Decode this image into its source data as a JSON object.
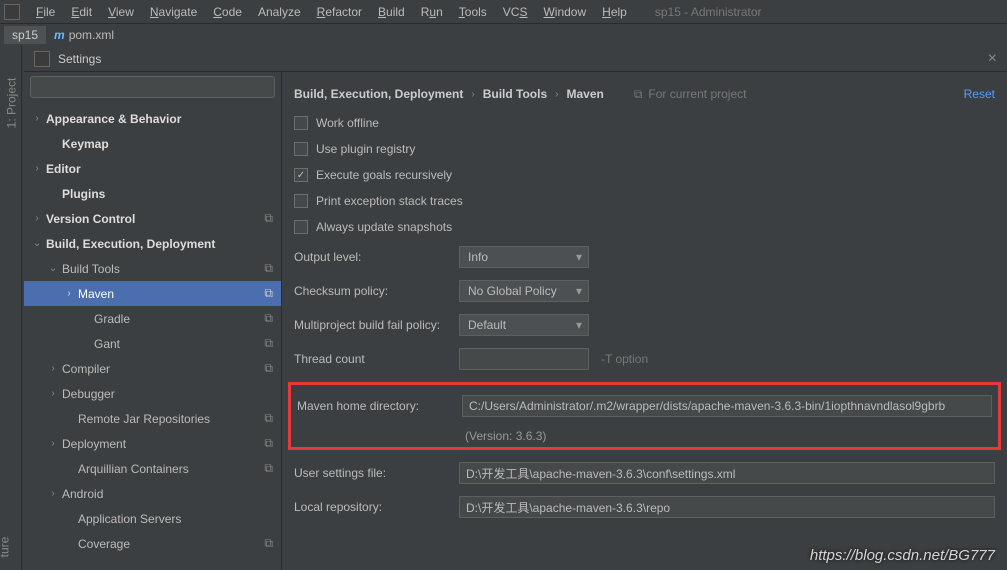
{
  "menubar": {
    "items": [
      "File",
      "Edit",
      "View",
      "Navigate",
      "Code",
      "Analyze",
      "Refactor",
      "Build",
      "Run",
      "Tools",
      "VCS",
      "Window",
      "Help"
    ],
    "mnemonics": [
      "F",
      "E",
      "V",
      "N",
      "C",
      "",
      "R",
      "B",
      "u",
      "T",
      "S",
      "W",
      "H"
    ],
    "title_extra": "sp15 - Administrator"
  },
  "tabs": {
    "project": "sp15",
    "file": "pom.xml"
  },
  "sidepanel": {
    "project": "1: Project",
    "structure": "ture"
  },
  "dialog": {
    "title": "Settings",
    "close": "×"
  },
  "search": {
    "placeholder": ""
  },
  "tree": [
    {
      "label": "Appearance & Behavior",
      "indent": 0,
      "arrow": "›",
      "bold": true,
      "badge": ""
    },
    {
      "label": "Keymap",
      "indent": 1,
      "arrow": "",
      "bold": true,
      "badge": ""
    },
    {
      "label": "Editor",
      "indent": 0,
      "arrow": "›",
      "bold": true,
      "badge": ""
    },
    {
      "label": "Plugins",
      "indent": 1,
      "arrow": "",
      "bold": true,
      "badge": ""
    },
    {
      "label": "Version Control",
      "indent": 0,
      "arrow": "›",
      "bold": true,
      "badge": "⧉"
    },
    {
      "label": "Build, Execution, Deployment",
      "indent": 0,
      "arrow": "⌄",
      "bold": true,
      "badge": ""
    },
    {
      "label": "Build Tools",
      "indent": 1,
      "arrow": "⌄",
      "bold": false,
      "badge": "⧉"
    },
    {
      "label": "Maven",
      "indent": 2,
      "arrow": "›",
      "bold": false,
      "badge": "⧉",
      "selected": true
    },
    {
      "label": "Gradle",
      "indent": 3,
      "arrow": "",
      "bold": false,
      "badge": "⧉"
    },
    {
      "label": "Gant",
      "indent": 3,
      "arrow": "",
      "bold": false,
      "badge": "⧉"
    },
    {
      "label": "Compiler",
      "indent": 1,
      "arrow": "›",
      "bold": false,
      "badge": "⧉"
    },
    {
      "label": "Debugger",
      "indent": 1,
      "arrow": "›",
      "bold": false,
      "badge": ""
    },
    {
      "label": "Remote Jar Repositories",
      "indent": 2,
      "arrow": "",
      "bold": false,
      "badge": "⧉"
    },
    {
      "label": "Deployment",
      "indent": 1,
      "arrow": "›",
      "bold": false,
      "badge": "⧉"
    },
    {
      "label": "Arquillian Containers",
      "indent": 2,
      "arrow": "",
      "bold": false,
      "badge": "⧉"
    },
    {
      "label": "Android",
      "indent": 1,
      "arrow": "›",
      "bold": false,
      "badge": ""
    },
    {
      "label": "Application Servers",
      "indent": 2,
      "arrow": "",
      "bold": false,
      "badge": ""
    },
    {
      "label": "Coverage",
      "indent": 2,
      "arrow": "",
      "bold": false,
      "badge": "⧉"
    }
  ],
  "breadcrumb": {
    "a": "Build, Execution, Deployment",
    "b": "Build Tools",
    "c": "Maven",
    "for_project": "For current project",
    "reset": "Reset"
  },
  "checks": {
    "work_offline": "Work offline",
    "use_plugin_registry": "Use plugin registry",
    "execute_goals": "Execute goals recursively",
    "print_exception": "Print exception stack traces",
    "always_update": "Always update snapshots"
  },
  "form": {
    "output_level_label": "Output level:",
    "output_level_value": "Info",
    "checksum_label": "Checksum policy:",
    "checksum_value": "No Global Policy",
    "multiproject_label": "Multiproject build fail policy:",
    "multiproject_value": "Default",
    "thread_label": "Thread count",
    "thread_value": "",
    "thread_hint": "-T option",
    "maven_home_label": "Maven home directory:",
    "maven_home_value": "C:/Users/Administrator/.m2/wrapper/dists/apache-maven-3.6.3-bin/1iopthnavndlasol9gbrb",
    "maven_version": "(Version: 3.6.3)",
    "user_settings_label": "User settings file:",
    "user_settings_value": "D:\\开发工具\\apache-maven-3.6.3\\conf\\settings.xml",
    "local_repo_label": "Local repository:",
    "local_repo_value": "D:\\开发工具\\apache-maven-3.6.3\\repo"
  },
  "watermark": "https://blog.csdn.net/BG777"
}
